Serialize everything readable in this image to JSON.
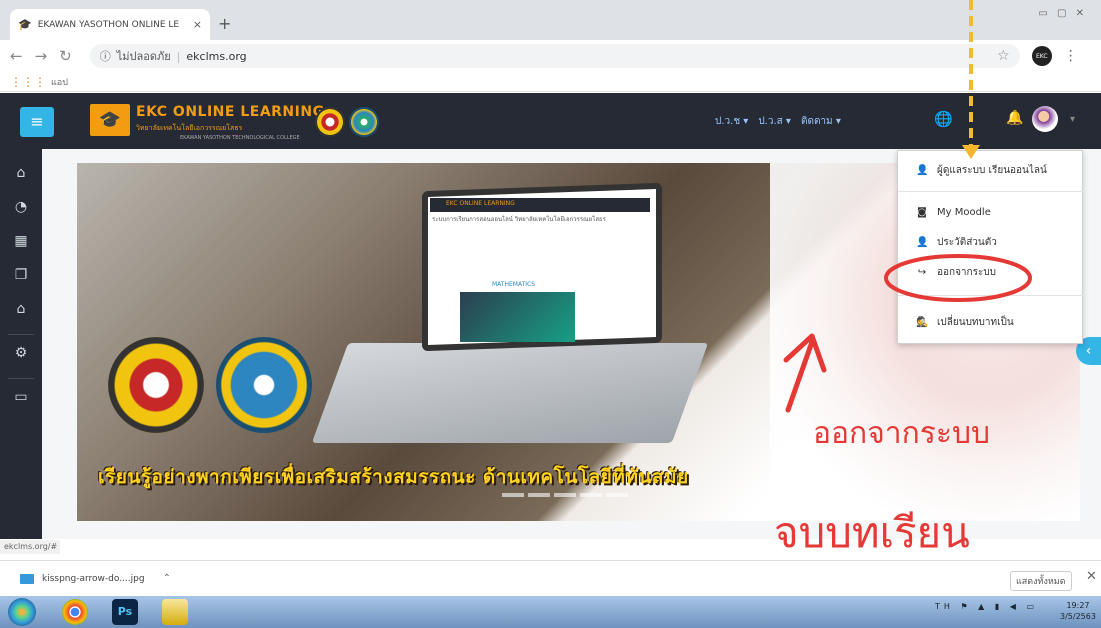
{
  "browser": {
    "tab_title": "EKAWAN YASOTHON ONLINE LE",
    "tab_close": "×",
    "new_tab": "+",
    "security": "ไม่ปลอดภัย",
    "url": "ekclms.org",
    "profile": "EKC",
    "bookmark_label": "แอป",
    "status_url": "ekclms.org/#"
  },
  "navbar": {
    "brand": "EKC ONLINE LEARNING",
    "brand_sub": "วิทยาลัยเทคโนโลยีเอกวรรณยโสธร",
    "brand_sub2": "EKAWAN YASOTHON TECHNOLOGICAL COLLEGE",
    "menus": [
      "ป.ว.ช",
      "ป.ว.ส",
      "ติดตาม"
    ]
  },
  "user_menu": {
    "items": [
      {
        "label": "ผู้ดูแลระบบ เรียนออนไลน์",
        "icon": "user-icon"
      },
      {
        "label": "My Moodle",
        "icon": "dashboard-icon"
      },
      {
        "label": "ประวัติส่วนตัว",
        "icon": "user-icon"
      },
      {
        "label": "ออกจากระบบ",
        "icon": "logout-icon"
      },
      {
        "label": "เปลี่ยนบทบาทเป็น",
        "icon": "user-secret-icon"
      }
    ]
  },
  "banner": {
    "slogan": "เรียนรู้อย่างพากเพียรเพื่อเสริมสร้างสมรรถนะ ด้านเทคโนโลยีที่ทันสมัย",
    "mini_brand": "EKC ONLINE LEARNING",
    "mini_title": "ระบบการเรียนการสอนออนไลน์ วิทยาลัยเทคโนโลยีเอกวรรณยโสธร",
    "mini_tag": "MATHEMATICS",
    "annotation_logout": "ออกจากระบบ",
    "annotation_end": "จบบทเรียน"
  },
  "downloads": {
    "file": "kisspng-arrow-do....jpg",
    "show_all": "แสดงทั้งหมด"
  },
  "taskbar": {
    "ps": "Ps",
    "tray": "TH",
    "time": "19:27",
    "date": "3/5/2563"
  },
  "colors": {
    "navbar": "#252a34",
    "accent": "#33b5e5",
    "brand": "#f39c12",
    "annotation": "#e53935",
    "arrow": "#f5b82e"
  }
}
